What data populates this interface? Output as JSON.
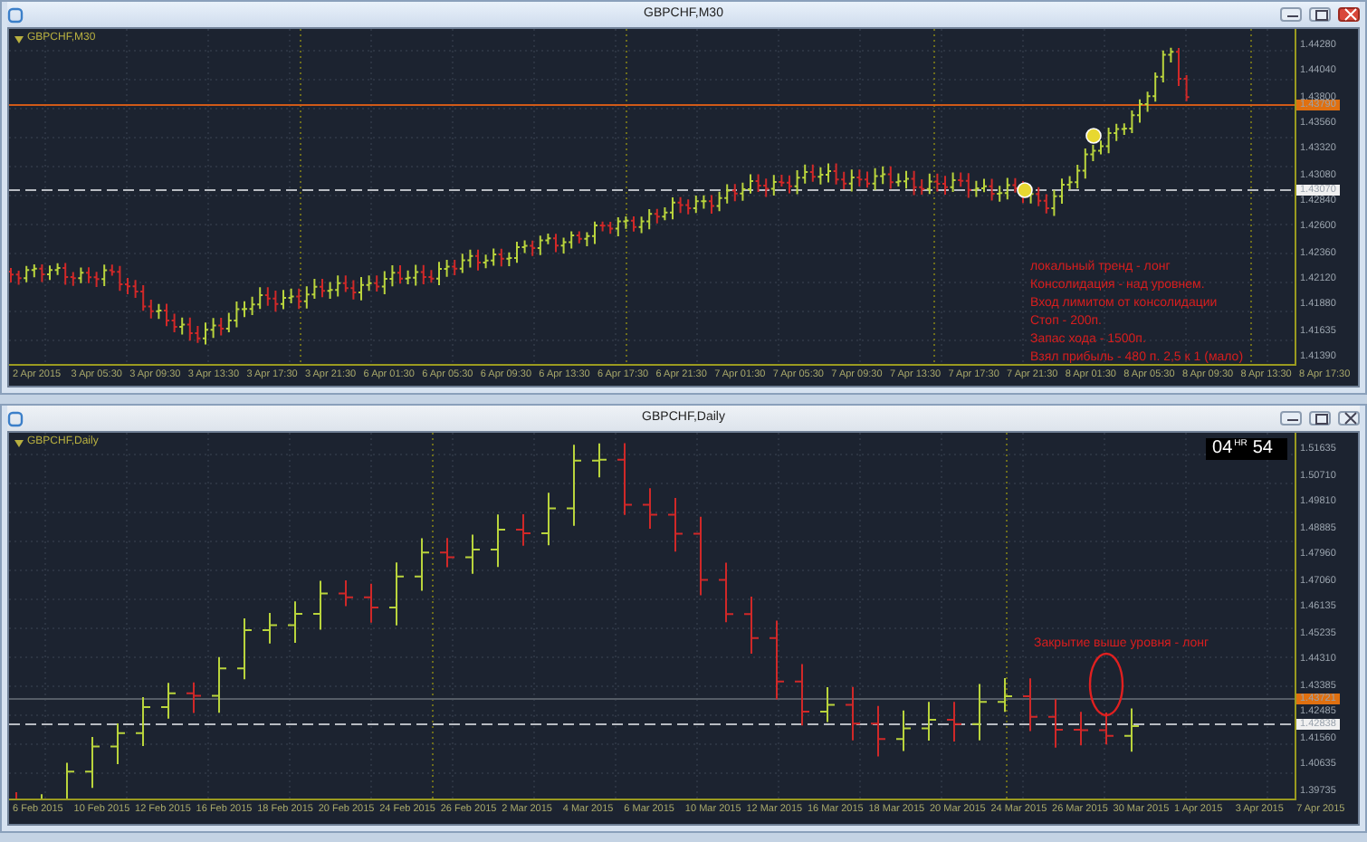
{
  "windows": [
    {
      "title": "GBPCHF,M30",
      "active": true,
      "kind": "intraday",
      "chart_label": "GBPCHF,M30",
      "price_ticks": [
        "1.44280",
        "1.44040",
        "1.43800",
        "1.43560",
        "1.43320",
        "1.43080",
        "1.42840",
        "1.42600",
        "1.42360",
        "1.42120",
        "1.41880",
        "1.41635",
        "1.41390"
      ],
      "price_tags": [
        {
          "kind": "level",
          "text": "1.43790"
        },
        {
          "kind": "bid",
          "text": "1.43070"
        }
      ],
      "time_labels": [
        "2 Apr 2015",
        "3 Apr 05:30",
        "3 Apr 09:30",
        "3 Apr 13:30",
        "3 Apr 17:30",
        "3 Apr 21:30",
        "6 Apr 01:30",
        "6 Apr 05:30",
        "6 Apr 09:30",
        "6 Apr 13:30",
        "6 Apr 17:30",
        "6 Apr 21:30",
        "7 Apr 01:30",
        "7 Apr 05:30",
        "7 Apr 09:30",
        "7 Apr 13:30",
        "7 Apr 17:30",
        "7 Apr 21:30",
        "8 Apr 01:30",
        "8 Apr 05:30",
        "8 Apr 09:30",
        "8 Apr 13:30",
        "8 Apr 17:30"
      ],
      "notes": [
        "локальный тренд - лонг",
        "Консолидация  - над уровнем.",
        "Вход лимитом от консолидации",
        "Стоп - 200п.",
        "Запас хода  - 1500п.",
        "Взял прибыль - 480 п. 2,5 к 1 (мало)"
      ]
    },
    {
      "title": "GBPCHF,Daily",
      "active": false,
      "kind": "daily",
      "chart_label": "GBPCHF,Daily",
      "countdown": {
        "hours": "04",
        "unit": "HR",
        "minutes": "54"
      },
      "price_ticks": [
        "1.51635",
        "1.50710",
        "1.49810",
        "1.48885",
        "1.47960",
        "1.47060",
        "1.46135",
        "1.45235",
        "1.44310",
        "1.43385",
        "1.42485",
        "1.41560",
        "1.40635",
        "1.39735"
      ],
      "price_tags": [
        {
          "kind": "level",
          "text": "1.43721"
        },
        {
          "kind": "bid",
          "text": "1.42838"
        }
      ],
      "time_labels": [
        "6 Feb 2015",
        "10 Feb 2015",
        "12 Feb 2015",
        "16 Feb 2015",
        "18 Feb 2015",
        "20 Feb 2015",
        "24 Feb 2015",
        "26 Feb 2015",
        "2 Mar 2015",
        "4 Mar 2015",
        "6 Mar 2015",
        "10 Mar 2015",
        "12 Mar 2015",
        "16 Mar 2015",
        "18 Mar 2015",
        "20 Mar 2015",
        "24 Mar 2015",
        "26 Mar 2015",
        "30 Mar 2015",
        "1 Apr 2015",
        "3 Apr 2015",
        "7 Apr 2015"
      ],
      "notes": [
        "Закрытие выше уровня - лонг"
      ]
    }
  ]
}
